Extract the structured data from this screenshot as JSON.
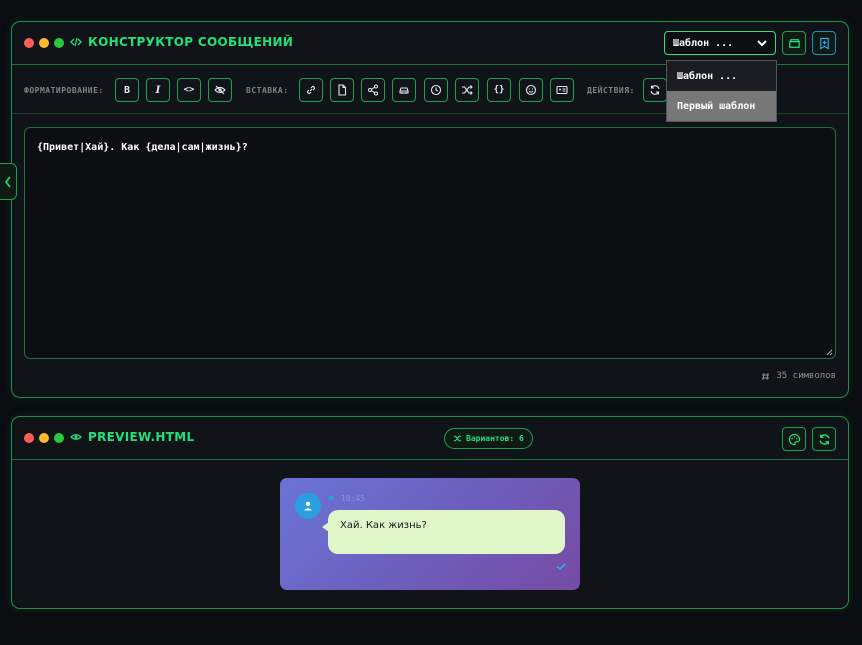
{
  "constructor": {
    "title": "КОНСТРУКТОР СООБЩЕНИЙ",
    "template_select": {
      "value": "Шаблон ...",
      "options": [
        "Шаблон ...",
        "Первый шаблон"
      ],
      "highlighted": "Первый шаблон"
    },
    "toolbar": {
      "format_label": "ФОРМАТИРОВАНИЕ:",
      "insert_label": "ВСТАВКА:",
      "actions_label": "ДЕЙСТВИЯ:",
      "bold_label": "B",
      "italic_label": "I",
      "code_label": "<>",
      "braces_label": "{}"
    },
    "editor_text": "{Привет|Хай}. Как {дела|сам|жизнь}?",
    "char_count": "35 символов"
  },
  "preview": {
    "title": "PREVIEW.HTML",
    "variants_badge": "Вариантов: 6",
    "message": {
      "time": "10:45",
      "text": "Хай. Как жизнь?"
    }
  },
  "colors": {
    "accent": "#22e07a",
    "border": "#1f9f55",
    "bubble": "#dff6c8",
    "preview_gradient_start": "#6a74d6",
    "preview_gradient_end": "#764ba2"
  }
}
